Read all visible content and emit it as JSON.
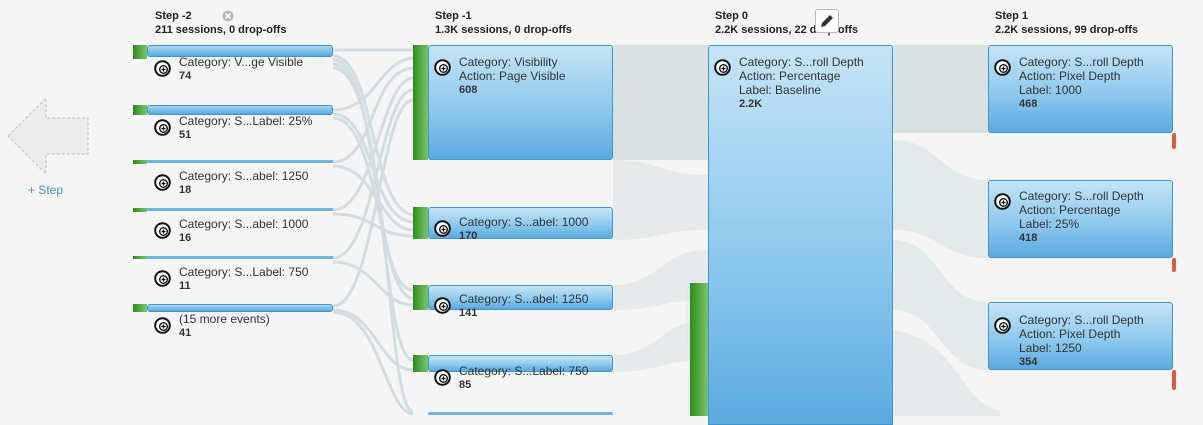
{
  "nav": {
    "add_step": "+ Step"
  },
  "steps": [
    {
      "title": "Step -2",
      "summary": "211 sessions, 0 drop-offs"
    },
    {
      "title": "Step -1",
      "summary": "1.3K sessions, 0 drop-offs"
    },
    {
      "title": "Step 0",
      "summary": "2.2K sessions, 22 drop-offs"
    },
    {
      "title": "Step 1",
      "summary": "2.2K sessions, 99 drop-offs"
    }
  ],
  "nodes": {
    "s2": [
      {
        "lines": [
          "Category: V...ge Visible"
        ],
        "count": "74"
      },
      {
        "lines": [
          "Category: S...Label: 25%"
        ],
        "count": "51"
      },
      {
        "lines": [
          "Category: S...abel: 1250"
        ],
        "count": "18"
      },
      {
        "lines": [
          "Category: S...abel: 1000"
        ],
        "count": "16"
      },
      {
        "lines": [
          "Category: S...Label: 750"
        ],
        "count": "11"
      },
      {
        "lines": [
          "(15 more events)"
        ],
        "count": "41"
      }
    ],
    "s1": [
      {
        "lines": [
          "Category: Visibility",
          "Action: Page Visible"
        ],
        "count": "608"
      },
      {
        "lines": [
          "Category: S...abel: 1000"
        ],
        "count": "170"
      },
      {
        "lines": [
          "Category: S...abel: 1250"
        ],
        "count": "141"
      },
      {
        "lines": [
          "Category: S...Label: 750"
        ],
        "count": "85"
      }
    ],
    "s0": [
      {
        "lines": [
          "Category: S...roll Depth",
          "Action: Percentage",
          "Label: Baseline"
        ],
        "count": "2.2K"
      }
    ],
    "s1b": [
      {
        "lines": [
          "Category: S...roll Depth",
          "Action: Pixel Depth",
          "Label: 1000"
        ],
        "count": "468"
      },
      {
        "lines": [
          "Category: S...roll Depth",
          "Action: Percentage",
          "Label: 25%"
        ],
        "count": "418"
      },
      {
        "lines": [
          "Category: S...roll Depth",
          "Action: Pixel Depth",
          "Label: 1250"
        ],
        "count": "354"
      }
    ]
  }
}
